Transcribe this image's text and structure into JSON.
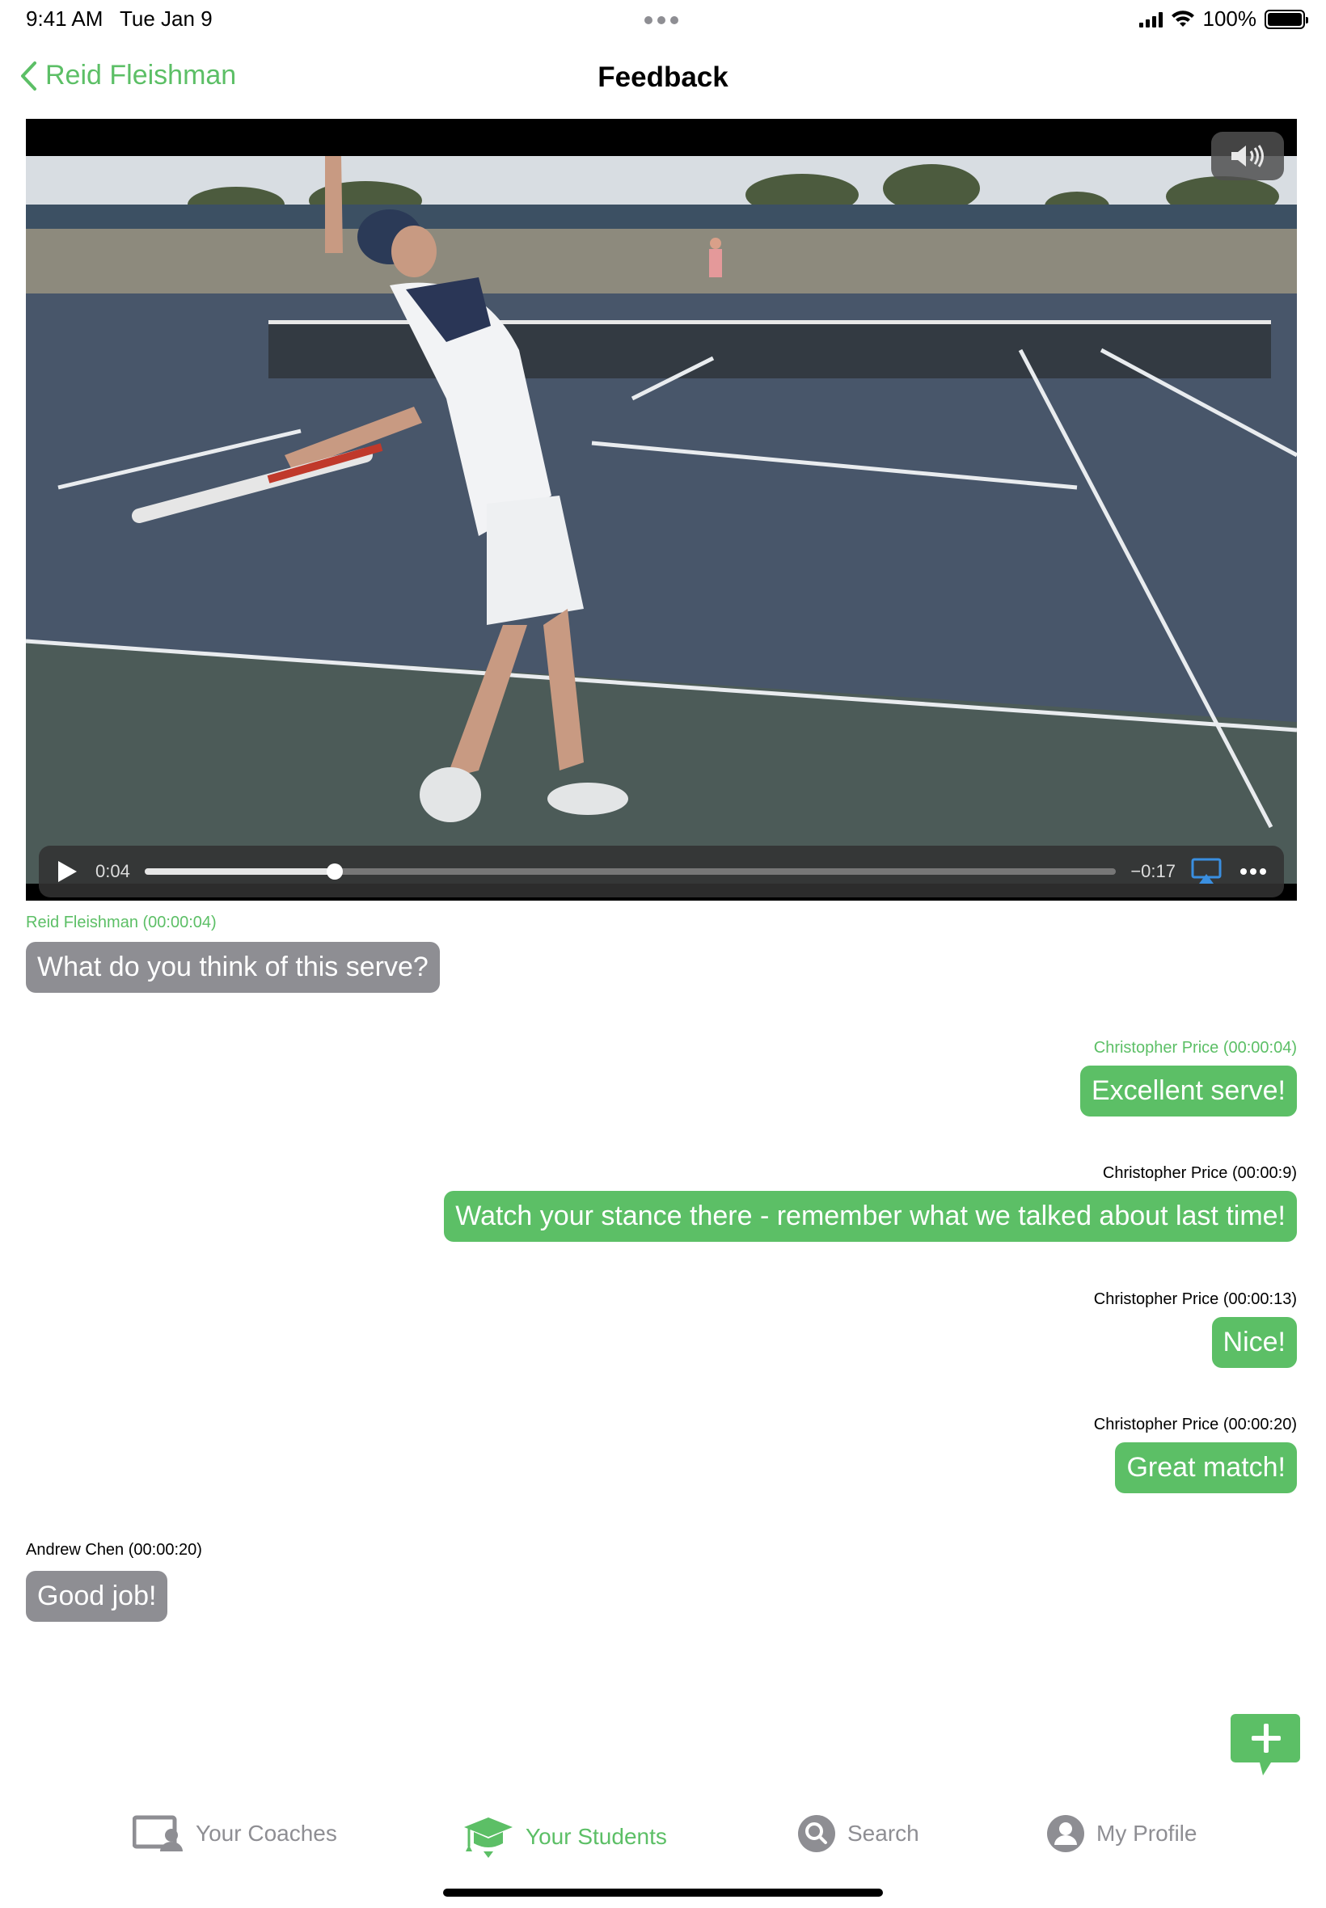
{
  "status_bar": {
    "time": "9:41 AM",
    "date": "Tue Jan 9",
    "battery": "100%"
  },
  "nav": {
    "back_label": "Reid Fleishman",
    "title": "Feedback"
  },
  "video": {
    "elapsed": "0:04",
    "remaining": "−0:17",
    "progress": 0.196
  },
  "messages": [
    {
      "author": "Reid Fleishman (00:00:04)",
      "text": "What do you think of this serve?"
    },
    {
      "author": "Christopher Price (00:00:04)",
      "text": "Excellent serve!"
    },
    {
      "author": "Christopher Price (00:00:9)",
      "text": "Watch your stance there - remember what we talked about last time!"
    },
    {
      "author": "Christopher Price (00:00:13)",
      "text": "Nice!"
    },
    {
      "author": "Christopher Price (00:00:20)",
      "text": "Great match!"
    },
    {
      "author": "Andrew Chen (00:00:20)",
      "text": "Good job!"
    }
  ],
  "tabs": [
    {
      "label": "Your Coaches",
      "icon": "coaches-icon"
    },
    {
      "label": "Your Students",
      "icon": "graduation-cap-icon"
    },
    {
      "label": "Search",
      "icon": "search-icon"
    },
    {
      "label": "My Profile",
      "icon": "profile-icon"
    }
  ],
  "colors": {
    "accent": "#5cbf66",
    "bubble_gray": "#8e8e93"
  }
}
